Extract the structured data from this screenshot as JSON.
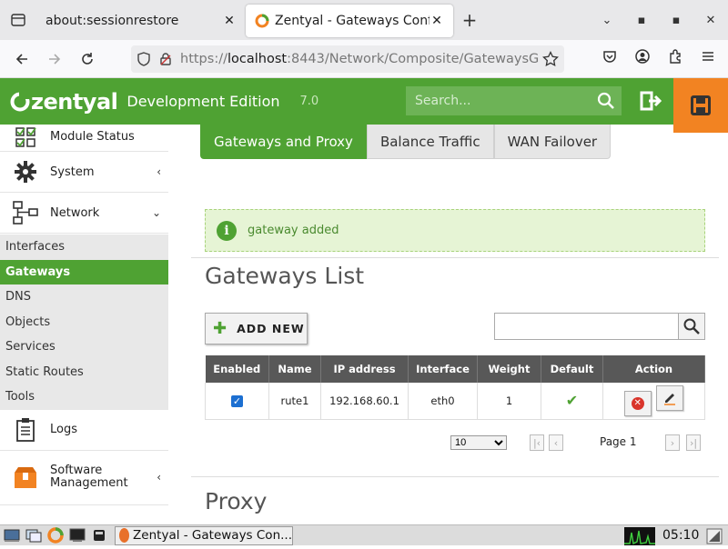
{
  "browser": {
    "tabs": [
      {
        "title": "about:sessionrestore",
        "active": false
      },
      {
        "title": "Zentyal - Gateways Conf",
        "active": true
      }
    ],
    "new_tab_symbol": "+",
    "url_prefix": "https://",
    "url_host": "localhost",
    "url_rest": ":8443/Network/Composite/GatewaysG"
  },
  "header": {
    "logo_text": "zentyal",
    "edition": "Development Edition",
    "version": "7.0",
    "search_placeholder": "Search..."
  },
  "sidebar": {
    "menus": [
      {
        "label": "Module Status",
        "icon": "module-status-icon"
      },
      {
        "label": "System",
        "icon": "gear-icon",
        "arrow": "‹"
      },
      {
        "label": "Network",
        "icon": "network-icon",
        "arrow": "⌄"
      }
    ],
    "network_items": [
      "Interfaces",
      "Gateways",
      "DNS",
      "Objects",
      "Services",
      "Static Routes",
      "Tools"
    ],
    "active_item": "Gateways",
    "bottom_menus": [
      {
        "label": "Logs",
        "icon": "clipboard-icon"
      },
      {
        "label": "Software Management",
        "icon": "box-icon",
        "arrow": "‹"
      }
    ]
  },
  "main": {
    "tabs": [
      "Gateways and Proxy",
      "Balance Traffic",
      "WAN Failover"
    ],
    "active_tab": "Gateways and Proxy",
    "notice": "gateway added",
    "gateways_title": "Gateways List",
    "add_new_label": "ADD NEW",
    "table": {
      "headers": [
        "Enabled",
        "Name",
        "IP address",
        "Interface",
        "Weight",
        "Default",
        "Action"
      ],
      "rows": [
        {
          "enabled": true,
          "name": "rute1",
          "ip": "192.168.60.1",
          "interface": "eth0",
          "weight": "1",
          "default": true
        }
      ]
    },
    "page_size": "10",
    "page_label": "Page 1",
    "proxy_title": "Proxy"
  },
  "taskbar": {
    "window_title": "Zentyal - Gateways Con...",
    "clock": "05:10"
  },
  "colors": {
    "brand_green": "#4fa233",
    "save_orange": "#f28322"
  }
}
